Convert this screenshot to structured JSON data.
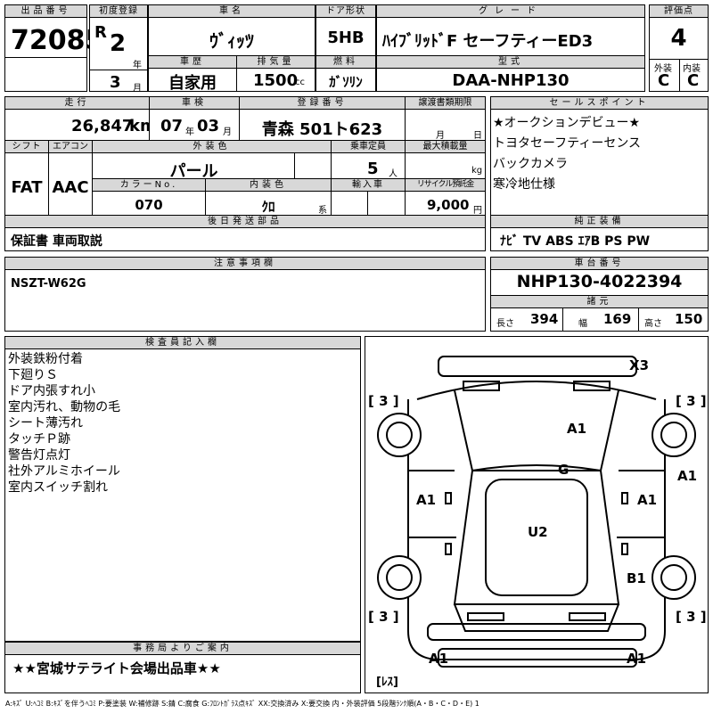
{
  "top": {
    "lot_no_label": "出品番号",
    "lot_no": "72085",
    "first_reg_label": "初度登録",
    "era": "R",
    "year_num": "2",
    "year_unit": "年",
    "month_num": "3",
    "month_unit": "月",
    "car_name_label": "車名",
    "car_name": "ｳﾞｨｯﾂ",
    "door_label": "ドア形状",
    "door": "5HB",
    "grade_label": "グレード",
    "grade": "ﾊｲﾌﾞﾘｯﾄﾞF セーフティーED3",
    "score_label": "評価点",
    "score": "4",
    "ext_label": "外装",
    "int_label": "内装",
    "ext_grade": "C",
    "int_grade": "C",
    "history_label": "車歴",
    "history": "自家用",
    "disp_label": "排気量",
    "disp": "1500",
    "disp_unit": "cc",
    "fuel_label": "燃料",
    "fuel": "ｶﾞｿﾘﾝ",
    "model_label": "型式",
    "model": "DAA-NHP130"
  },
  "row2": {
    "mileage_label": "走行",
    "mileage": "26,847",
    "mileage_unit": "km",
    "inspection_label": "車検",
    "insp_year": "07",
    "insp_year_unit": "年",
    "insp_month": "03",
    "insp_month_unit": "月",
    "reg_label": "登録番号",
    "reg": "青森 501ト623",
    "transfer_label": "譲渡書類期限",
    "transfer_month": "月",
    "transfer_day": "日",
    "shift_label": "シフト",
    "shift": "FAT",
    "ac_label": "エアコン",
    "ac": "AAC",
    "color_label": "外装色",
    "color": "パール",
    "capacity_label": "乗車定員",
    "capacity": "5",
    "capacity_unit": "人",
    "load_label": "最大積載量",
    "load_unit": "kg",
    "color_no_label": "カラーNo.",
    "color_no": "070",
    "interior_label": "内装色",
    "interior": "ｸﾛ",
    "interior_unit": "系",
    "import_label": "輸入車",
    "recycle_label": "リサイクル預託金",
    "recycle": "9,000",
    "recycle_unit": "円",
    "later_label": "後日発送部品",
    "later": "保証書 車両取説"
  },
  "sales": {
    "label": "セールスポイント",
    "items": [
      "★オークションデビュー★",
      "トヨタセーフティーセンス",
      "バックカメラ",
      "寒冷地仕様"
    ]
  },
  "equipment": {
    "label": "純正装備",
    "value": "ﾅﾋﾞ TV ABS ｴｱB PS PW"
  },
  "notes": {
    "label": "注意事項欄",
    "value": "NSZT-W62G"
  },
  "chassis": {
    "label": "車台番号",
    "value": "NHP130-4022394",
    "spec_label": "諸元",
    "length_label": "長さ",
    "length": "394",
    "width_label": "幅",
    "width": "169",
    "height_label": "高さ",
    "height": "150"
  },
  "inspector": {
    "label": "検査員記入欄",
    "items": [
      "外装鉄粉付着",
      "下廻りＳ",
      "ドア内張すれ小",
      "室内汚れ、動物の毛",
      "シート薄汚れ",
      "タッチＰ跡",
      "警告灯点灯",
      "社外アルミホイール",
      "室内スイッチ割れ"
    ]
  },
  "office": {
    "label": "事務局よりご案内",
    "value": "★★宮城サテライト会場出品車★★"
  },
  "diagram": {
    "tyre_fl": "[ 3 ]",
    "tyre_fr": "[ 3 ]",
    "tyre_rl": "[ 3 ]",
    "tyre_rr": "[ 3 ]",
    "x3": "X3",
    "a1_hood": "A1",
    "g": "G",
    "a1_right_fender": "A1",
    "a1_left_door": "A1",
    "a1_right_door": "A1",
    "u2": "U2",
    "b1": "B1",
    "a1_rear_left": "A1",
    "a1_rear_right": "A1",
    "remarks": "[ﾚｽ]"
  },
  "legend": "A:ｷｽﾞ U:ﾍｺﾐ B:ｷｽﾞを伴うﾍｺﾐ P:要塗装 W:補修跡 S:錆 C:腐食 G:ﾌﾛﾝﾄｶﾞﾗｽ点ｷｽﾞ XX:交換済み X:要交換 内・外装評価 5段階ﾗﾝｸ順(A・B・C・D・E) 1"
}
